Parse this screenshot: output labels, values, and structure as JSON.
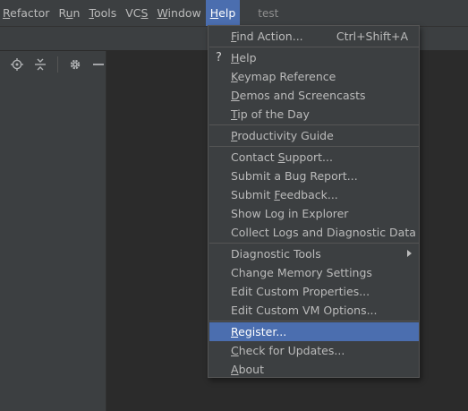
{
  "menubar": {
    "items": [
      {
        "pre": "",
        "mn": "R",
        "post": "efactor"
      },
      {
        "pre": "R",
        "mn": "u",
        "post": "n"
      },
      {
        "pre": "",
        "mn": "T",
        "post": "ools"
      },
      {
        "pre": "VC",
        "mn": "S",
        "post": ""
      },
      {
        "pre": "",
        "mn": "W",
        "post": "indow"
      },
      {
        "pre": "",
        "mn": "H",
        "post": "elp"
      }
    ],
    "project_title": "test"
  },
  "help_menu": {
    "find_action": {
      "pre": "",
      "mn": "F",
      "post": "ind Action...",
      "shortcut": "Ctrl+Shift+A"
    },
    "help": {
      "icon": "?",
      "pre": "",
      "mn": "H",
      "post": "elp"
    },
    "keymap_reference": {
      "pre": "",
      "mn": "K",
      "post": "eymap Reference"
    },
    "demos": {
      "pre": "",
      "mn": "D",
      "post": "emos and Screencasts"
    },
    "tip_of_day": {
      "pre": "",
      "mn": "T",
      "post": "ip of the Day"
    },
    "productivity_guide": {
      "pre": "",
      "mn": "P",
      "post": "roductivity Guide"
    },
    "contact_support": {
      "pre": "Contact ",
      "mn": "S",
      "post": "upport..."
    },
    "submit_bug": {
      "pre": "Submit a Bug Report...",
      "mn": "",
      "post": ""
    },
    "submit_feedback": {
      "pre": "Submit ",
      "mn": "F",
      "post": "eedback..."
    },
    "show_log": {
      "pre": "Show Log in Explorer",
      "mn": "",
      "post": ""
    },
    "collect_logs": {
      "pre": "Collect Logs and Diagnostic Data",
      "mn": "",
      "post": ""
    },
    "diagnostic_tools": {
      "pre": "Diagnostic Tools",
      "mn": "",
      "post": ""
    },
    "change_memory": {
      "pre": "Change Memory Settings",
      "mn": "",
      "post": ""
    },
    "edit_properties": {
      "pre": "Edit Custom Properties...",
      "mn": "",
      "post": ""
    },
    "edit_vm_options": {
      "pre": "Edit Custom VM Options...",
      "mn": "",
      "post": ""
    },
    "register": {
      "pre": "",
      "mn": "R",
      "post": "egister..."
    },
    "check_updates": {
      "pre": "",
      "mn": "C",
      "post": "heck for Updates..."
    },
    "about": {
      "pre": "",
      "mn": "A",
      "post": "bout"
    }
  },
  "toolbar": {
    "icons": [
      "crosshair-icon",
      "collapse-icon",
      "gear-icon",
      "minimize-icon"
    ]
  },
  "colors": {
    "menubar_bg": "#3c3f41",
    "editor_bg": "#2b2b2b",
    "selection": "#4b6eaf",
    "text": "#bbbbbb"
  }
}
